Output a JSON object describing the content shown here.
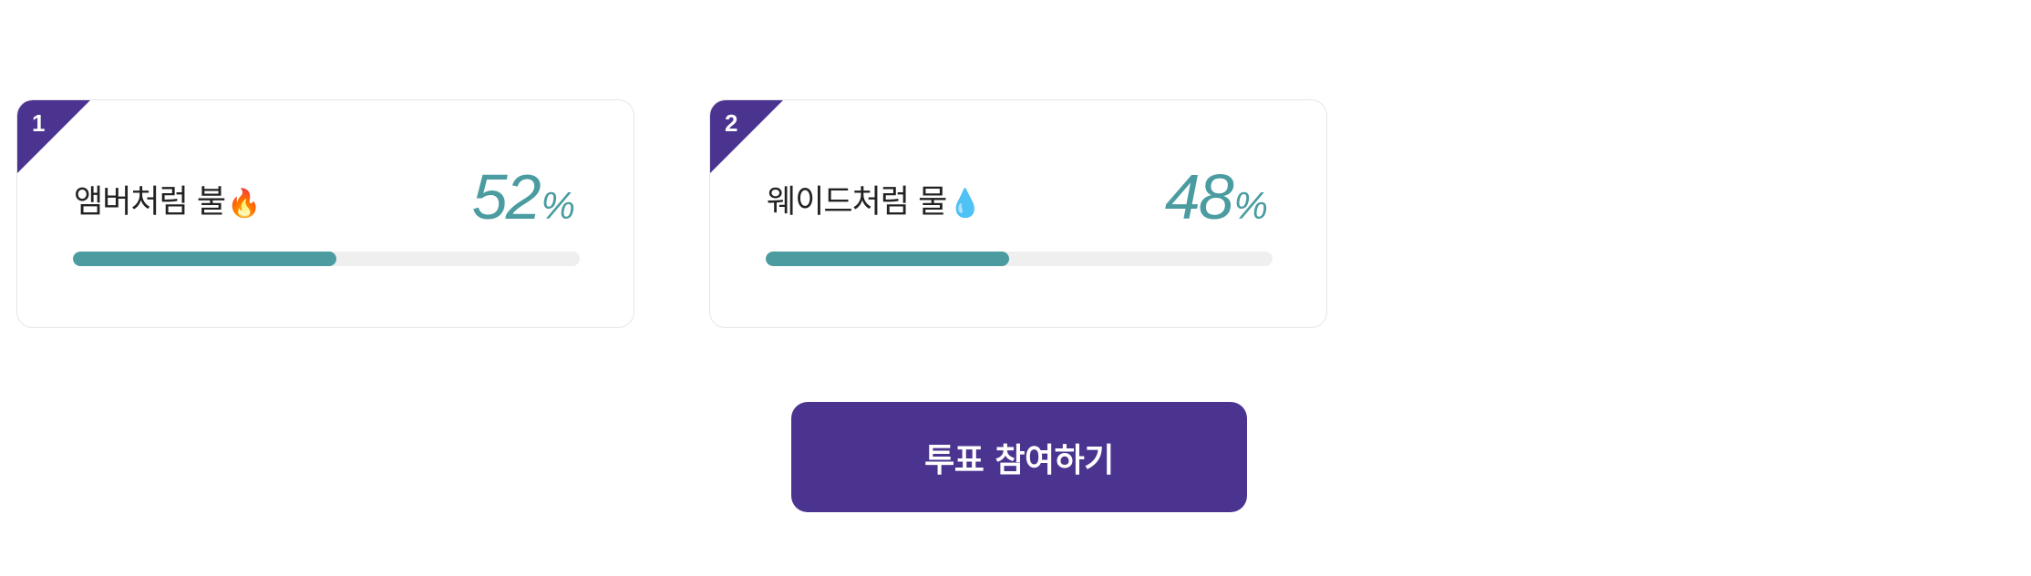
{
  "poll": {
    "options": [
      {
        "rank": "1",
        "label": "앰버처럼 불",
        "emoji": "🔥",
        "percent": "52",
        "unit": "%",
        "value": 0.52
      },
      {
        "rank": "2",
        "label": "웨이드처럼 물",
        "emoji": "💧",
        "percent": "48",
        "unit": "%",
        "value": 0.48
      }
    ],
    "vote_button_label": "투표 참여하기"
  },
  "colors": {
    "accent": "#4b3490",
    "bar": "#4a9ca0",
    "track": "#efefef"
  }
}
